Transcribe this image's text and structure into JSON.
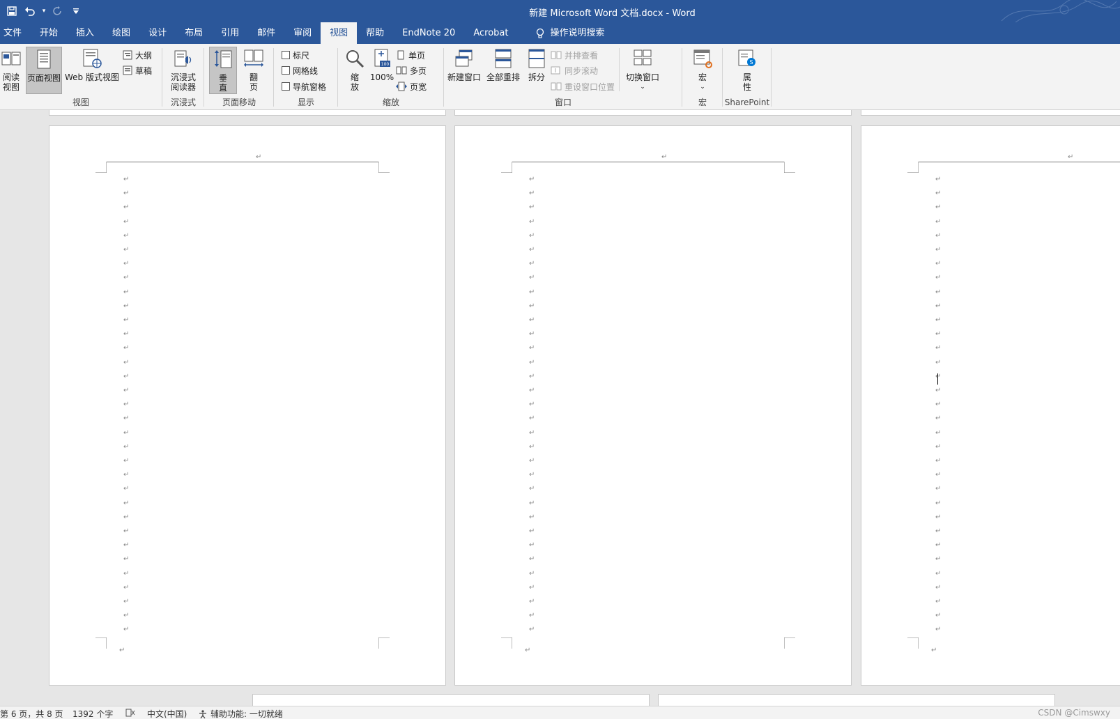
{
  "titlebar": {
    "title": "新建 Microsoft Word 文档.docx  -  Word",
    "qat": [
      "save-icon",
      "undo-icon",
      "redo-icon",
      "customize-icon"
    ]
  },
  "tabs": [
    "文件",
    "开始",
    "插入",
    "绘图",
    "设计",
    "布局",
    "引用",
    "邮件",
    "审阅",
    "视图",
    "帮助",
    "EndNote 20",
    "Acrobat"
  ],
  "active_tab": "视图",
  "tell_me": "操作说明搜索",
  "ribbon": {
    "views": {
      "label": "视图",
      "read_mode": "阅读\n视图",
      "print_layout": "页面视图",
      "web_layout": "Web 版式视图",
      "outline": "大纲",
      "draft": "草稿"
    },
    "immersive": {
      "label": "沉浸式",
      "reader": "沉浸式\n阅读器"
    },
    "page_movement": {
      "label": "页面移动",
      "vertical": "垂\n直",
      "side": "翻\n页"
    },
    "show": {
      "label": "显示",
      "ruler": "标尺",
      "gridlines": "网格线",
      "nav_pane": "导航窗格"
    },
    "zoom": {
      "label": "缩放",
      "zoom": "缩\n放",
      "hundred": "100%",
      "one_page": "单页",
      "multi_page": "多页",
      "page_width": "页宽"
    },
    "window": {
      "label": "窗口",
      "new_window": "新建窗口",
      "arrange_all": "全部重排",
      "split": "拆分",
      "side_by_side": "并排查看",
      "sync_scroll": "同步滚动",
      "reset_position": "重设窗口位置",
      "switch_windows": "切换窗口"
    },
    "macros": {
      "label": "宏",
      "macros": "宏"
    },
    "sharepoint": {
      "label": "SharePoint",
      "properties": "属\n性"
    }
  },
  "document": {
    "paragraph_mark": "↵",
    "pages_visible": 3
  },
  "status": {
    "page": "第 6 页，共 8 页",
    "words": "1392 个字",
    "language": "中文(中国)",
    "accessibility": "辅助功能: 一切就绪"
  },
  "watermark": "CSDN @Cimswxy",
  "colors": {
    "accent": "#2b579a",
    "ribbon_bg": "#f3f3f3",
    "doc_bg": "#e6e6e6"
  }
}
